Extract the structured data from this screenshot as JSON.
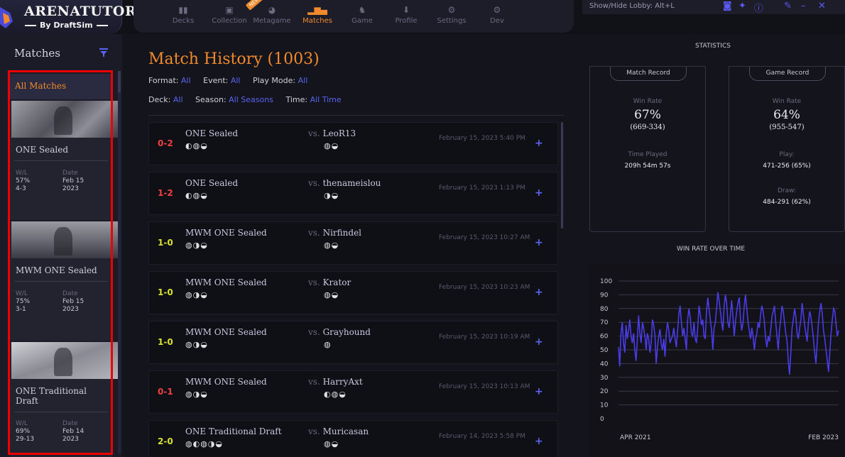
{
  "app": {
    "logo_title": "ARENATUTOR",
    "logo_subtitle": "By DraftSim"
  },
  "nav": {
    "items": [
      {
        "label": "Decks",
        "icon": "decks-icon",
        "active": false
      },
      {
        "label": "Collection",
        "icon": "collection-icon",
        "active": false
      },
      {
        "label": "Metagame",
        "icon": "metagame-icon",
        "active": false,
        "badge": "NEW"
      },
      {
        "label": "Matches",
        "icon": "bar-chart-icon",
        "active": true
      },
      {
        "label": "Game",
        "icon": "game-icon",
        "active": false
      },
      {
        "label": "Profile",
        "icon": "profile-icon",
        "active": false
      },
      {
        "label": "Settings",
        "icon": "gear-icon",
        "active": false
      },
      {
        "label": "Dev",
        "icon": "dev-gear-icon",
        "active": false
      }
    ],
    "active_color": "#f08a2c"
  },
  "topright": {
    "lobby_hint": "Show/Hide Lobby: Alt+L",
    "icons": [
      "discord-icon",
      "twitter-icon",
      "help-icon",
      "edit-icon",
      "minimize-icon",
      "close-icon"
    ]
  },
  "sidebar": {
    "title": "Matches",
    "all_matches_label": "All Matches",
    "cards": [
      {
        "name": "ONE Sealed",
        "wl_label": "W/L",
        "wl_pct": "57%",
        "wl_record": "4-3",
        "date_label": "Date",
        "date_md": "Feb 15",
        "date_year": "2023"
      },
      {
        "name": "MWM ONE Sealed",
        "wl_label": "W/L",
        "wl_pct": "75%",
        "wl_record": "3-1",
        "date_label": "Date",
        "date_md": "Feb 15",
        "date_year": "2023"
      },
      {
        "name": "ONE Traditional Draft",
        "wl_label": "W/L",
        "wl_pct": "69%",
        "wl_record": "29-13",
        "date_label": "Date",
        "date_md": "Feb 14",
        "date_year": "2023"
      }
    ]
  },
  "main": {
    "title": "Match History (1003)",
    "filters_row1": [
      {
        "label": "Format:",
        "value": "All"
      },
      {
        "label": "Event:",
        "value": "All"
      },
      {
        "label": "Play Mode:",
        "value": "All"
      }
    ],
    "filters_row2": [
      {
        "label": "Deck:",
        "value": "All"
      },
      {
        "label": "Season:",
        "value": "All Seasons"
      },
      {
        "label": "Time:",
        "value": "All Time"
      }
    ],
    "matches": [
      {
        "score": "0-2",
        "result": "loss",
        "event": "ONE Sealed",
        "deck_mana": "◐◍◒",
        "vs": "vs.",
        "opponent": "LeoR13",
        "opp_mana": "◍◒",
        "date": "February 15, 2023 5:40 PM",
        "plus": "+"
      },
      {
        "score": "1-2",
        "result": "loss",
        "event": "ONE Sealed",
        "deck_mana": "◐◍◒",
        "vs": "vs.",
        "opponent": "thenameislou",
        "opp_mana": "◑◒",
        "date": "February 15, 2023 1:13 PM",
        "plus": "+"
      },
      {
        "score": "1-0",
        "result": "win",
        "event": "MWM ONE Sealed",
        "deck_mana": "◍◑◒",
        "vs": "vs.",
        "opponent": "Nirfindel",
        "opp_mana": "◍◒",
        "date": "February 15, 2023 10:27 AM",
        "plus": "+"
      },
      {
        "score": "1-0",
        "result": "win",
        "event": "MWM ONE Sealed",
        "deck_mana": "◍◑◒",
        "vs": "vs.",
        "opponent": "Krator",
        "opp_mana": "◍◒",
        "date": "February 15, 2023 10:23 AM",
        "plus": "+"
      },
      {
        "score": "1-0",
        "result": "win",
        "event": "MWM ONE Sealed",
        "deck_mana": "◍◑◒",
        "vs": "vs.",
        "opponent": "Grayhound",
        "opp_mana": "◍",
        "date": "February 15, 2023 10:19 AM",
        "plus": "+"
      },
      {
        "score": "0-1",
        "result": "loss",
        "event": "MWM ONE Sealed",
        "deck_mana": "◍◑◒",
        "vs": "vs.",
        "opponent": "HarryAxt",
        "opp_mana": "◐◍◒",
        "date": "February 15, 2023 10:13 AM",
        "plus": "+"
      },
      {
        "score": "2-0",
        "result": "win",
        "event": "ONE Traditional Draft",
        "deck_mana": "◍◐◍◑◒",
        "vs": "vs.",
        "opponent": "Muricasan",
        "opp_mana": "◍◒",
        "date": "February 14, 2023 5:58 PM",
        "plus": "+"
      }
    ]
  },
  "stats": {
    "title": "STATISTICS",
    "match_record": {
      "header": "Match Record",
      "win_rate_label": "Win Rate",
      "win_rate": "67%",
      "record": "(669-334)",
      "time_played_label": "Time Played",
      "time_played": "209h 54m 57s"
    },
    "game_record": {
      "header": "Game Record",
      "win_rate_label": "Win Rate",
      "win_rate": "64%",
      "record": "(955-547)",
      "play_label": "Play:",
      "play": "471-256 (65%)",
      "draw_label": "Draw:",
      "draw": "484-291 (62%)"
    },
    "win_rate_over_time_title": "WIN RATE OVER TIME"
  },
  "chart_data": {
    "type": "line",
    "title": "WIN RATE OVER TIME",
    "x_start_label": "APR 2021",
    "x_end_label": "FEB 2023",
    "ylim": [
      0,
      100
    ],
    "yticks": [
      0,
      10,
      20,
      30,
      40,
      50,
      60,
      70,
      80,
      90,
      100
    ],
    "grid": true,
    "line_color": "#4a3ce8",
    "series": [
      {
        "values": [
          52,
          38,
          62,
          70,
          55,
          48,
          68,
          58,
          64,
          72,
          60,
          55,
          62,
          50,
          42,
          58,
          75,
          62,
          55,
          70,
          66,
          60,
          50,
          62,
          58,
          48,
          55,
          72,
          68,
          60,
          40,
          52,
          60,
          65,
          54,
          50,
          58,
          45,
          62,
          70,
          64,
          55,
          58,
          60,
          66,
          58,
          52,
          64,
          76,
          82,
          70,
          60,
          66,
          58,
          50,
          72,
          80,
          74,
          62,
          60,
          70,
          58,
          55,
          66,
          82,
          76,
          68,
          72,
          60,
          58,
          78,
          88,
          80,
          72,
          64,
          50,
          66,
          70,
          80,
          92,
          86,
          78,
          70,
          64,
          82,
          90,
          84,
          70,
          66,
          76,
          86,
          74,
          60,
          70,
          78,
          84,
          88,
          72,
          64,
          70,
          82,
          90,
          80,
          70,
          64,
          58,
          66,
          60,
          50,
          58,
          62,
          70,
          66,
          76,
          82,
          78,
          70,
          58,
          52,
          60,
          56,
          64,
          74,
          78,
          82,
          70,
          60,
          50,
          64,
          72,
          82,
          78,
          70,
          62,
          56,
          42,
          32,
          48,
          66,
          72,
          80,
          74,
          62,
          58,
          66,
          72,
          84,
          76,
          68,
          62,
          56,
          70,
          78,
          74,
          66,
          58,
          48,
          40,
          56,
          70,
          78,
          84,
          76,
          64,
          58,
          50,
          42,
          34,
          48,
          62,
          72,
          80,
          78,
          68,
          60,
          64
        ]
      }
    ]
  }
}
